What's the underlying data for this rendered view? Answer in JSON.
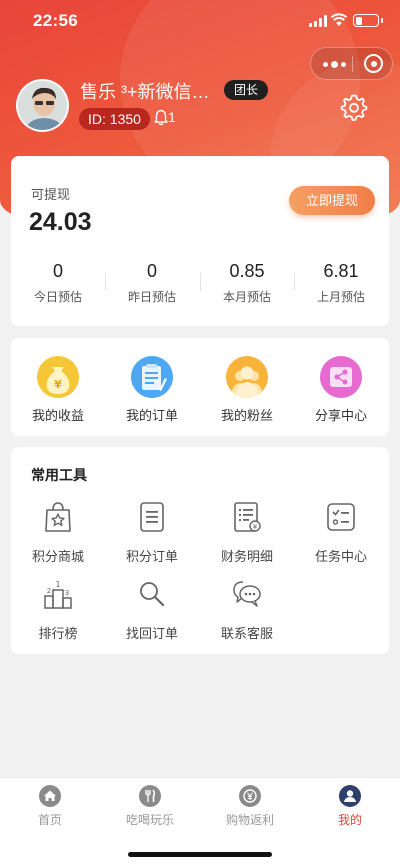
{
  "status_bar": {
    "time": "22:56"
  },
  "profile": {
    "name": "售乐 ³+新微信号...",
    "role_badge": "团长",
    "id_text": "ID: 1350",
    "notification_count": "1",
    "avatar_icon": "person-avatar",
    "settings_icon": "gear-icon"
  },
  "wallet": {
    "withdrawable_label": "可提现",
    "withdrawable_amount": "24.03",
    "withdraw_button": "立即提现",
    "stats": [
      {
        "value": "0",
        "label": "今日预估"
      },
      {
        "value": "0",
        "label": "昨日预估"
      },
      {
        "value": "0.85",
        "label": "本月预估"
      },
      {
        "value": "6.81",
        "label": "上月预估"
      }
    ]
  },
  "quick_actions": [
    {
      "label": "我的收益",
      "icon": "money-bag-icon",
      "color": "#f5c635"
    },
    {
      "label": "我的订单",
      "icon": "order-list-icon",
      "color": "#4ea7f2"
    },
    {
      "label": "我的粉丝",
      "icon": "fans-icon",
      "color": "#f7b33a"
    },
    {
      "label": "分享中心",
      "icon": "share-icon",
      "color": "#e76ad0"
    }
  ],
  "tools": {
    "title": "常用工具",
    "items": [
      {
        "label": "积分商城",
        "icon": "shopping-bag-star-icon"
      },
      {
        "label": "积分订单",
        "icon": "document-icon"
      },
      {
        "label": "财务明细",
        "icon": "finance-detail-icon"
      },
      {
        "label": "任务中心",
        "icon": "task-checklist-icon"
      },
      {
        "label": "排行榜",
        "icon": "podium-icon",
        "podium_digits": [
          "1",
          "2",
          "3"
        ]
      },
      {
        "label": "找回订单",
        "icon": "search-icon"
      },
      {
        "label": "联系客服",
        "icon": "chat-bubbles-icon"
      }
    ]
  },
  "tabbar": {
    "active_color": "#e04536",
    "items": [
      {
        "label": "首页",
        "icon": "home-icon",
        "active": false
      },
      {
        "label": "吃喝玩乐",
        "icon": "fork-knife-icon",
        "active": false
      },
      {
        "label": "购物返利",
        "icon": "yen-coin-icon",
        "active": false
      },
      {
        "label": "我的",
        "icon": "user-icon",
        "active": true
      }
    ]
  }
}
